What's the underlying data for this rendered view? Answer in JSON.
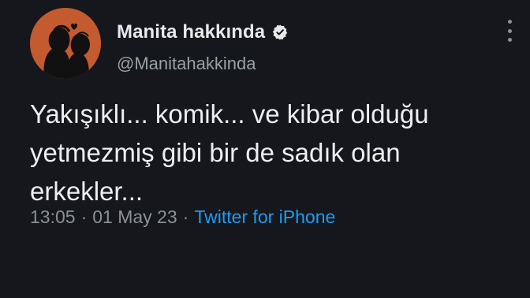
{
  "tweet": {
    "display_name": "Manita hakkında",
    "handle": "@Manitahakkinda",
    "verified": true,
    "text": "Yakışıklı... komik... ve kibar olduğu\nyetmezmiş gibi bir de sadık olan\nerkekler...",
    "time": "13:05",
    "separator": "·",
    "date": "01 May 23",
    "source": "Twitter for iPhone"
  },
  "colors": {
    "background": "#15171c",
    "text": "#e7e9ea",
    "secondary": "#8b9097",
    "link": "#1d9bf0",
    "avatar_bg": "#c45a2f"
  },
  "icons": {
    "verified": "verified-badge-icon",
    "more": "more-vertical-icon",
    "avatar": "couple-silhouette-avatar"
  }
}
